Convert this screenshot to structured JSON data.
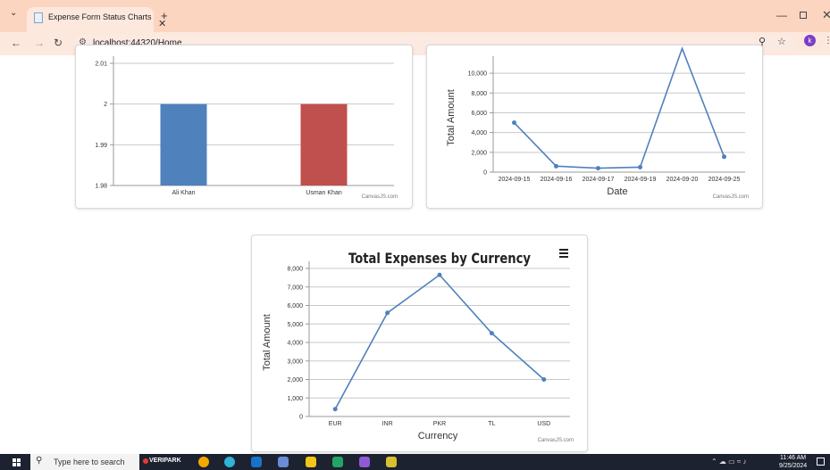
{
  "browser": {
    "tab_title": "Expense Form Status Charts",
    "url": "localhost:44320/Home"
  },
  "charts": [
    {
      "chart_data": {
        "type": "bar",
        "categories": [
          "Ali Khan",
          "Usman Khan"
        ],
        "values": [
          2,
          2
        ],
        "colors": [
          "#4f81bc",
          "#c0504e"
        ],
        "ylim": [
          1.98,
          2.01
        ],
        "yticks": [
          "1.98",
          "1.99",
          "2",
          "2.01"
        ],
        "grid": true,
        "credit": "CanvasJS.com"
      }
    },
    {
      "chart_data": {
        "type": "line",
        "categories": [
          "2024-09-15",
          "2024-09-16",
          "2024-09-17",
          "2024-09-19",
          "2024-09-20",
          "2024-09-25"
        ],
        "values": [
          5000,
          600,
          400,
          500,
          12500,
          1550
        ],
        "ylabel": "Total Amount",
        "xlabel": "Date",
        "ylim": [
          0,
          11000
        ],
        "yticks": [
          "0",
          "2,000",
          "4,000",
          "6,000",
          "8,000",
          "10,000"
        ],
        "color": "#4f81bc",
        "grid": true,
        "credit": "CanvasJS.com"
      }
    },
    {
      "chart_data": {
        "type": "line",
        "title": "Total Expenses by Currency",
        "categories": [
          "EUR",
          "INR",
          "PKR",
          "TL",
          "USD"
        ],
        "values": [
          400,
          5600,
          7650,
          4500,
          2000
        ],
        "ylabel": "Total Amount",
        "xlabel": "Currency",
        "ylim": [
          0,
          8000
        ],
        "yticks": [
          "0",
          "1,000",
          "2,000",
          "3,000",
          "4,000",
          "5,000",
          "6,000",
          "7,000",
          "8,000"
        ],
        "color": "#4f81bc",
        "grid": true,
        "menu_icon": "hamburger-icon",
        "credit": "CanvasJS.com"
      }
    }
  ],
  "taskbar": {
    "search_placeholder": "Type here to search",
    "pinned_label": "VERIPARK",
    "time": "11:46 AM",
    "date": "9/25/2024"
  }
}
